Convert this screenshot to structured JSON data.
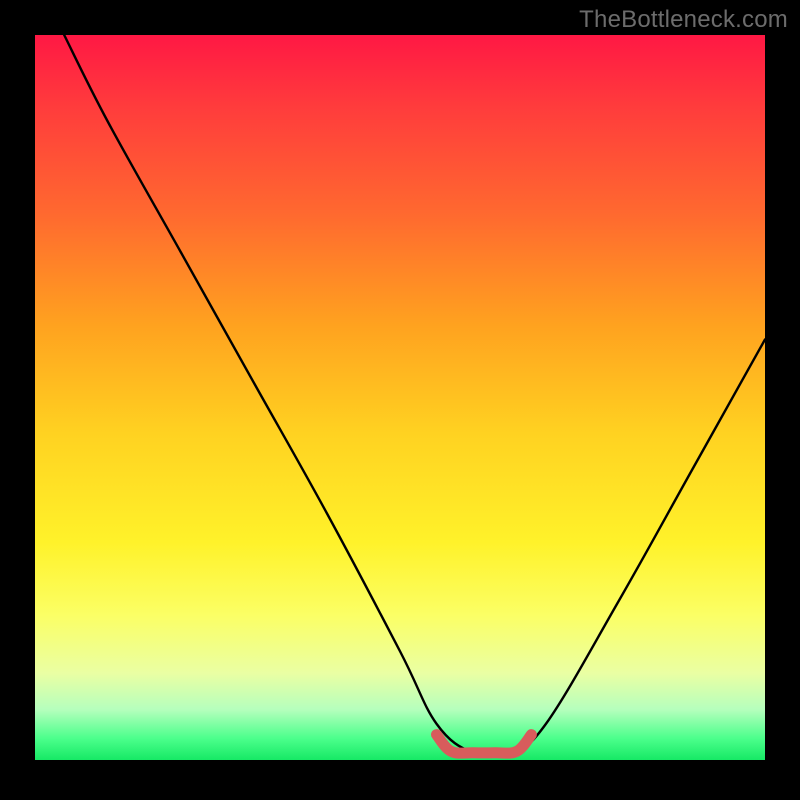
{
  "watermark": "TheBottleneck.com",
  "chart_data": {
    "type": "line",
    "title": "",
    "xlabel": "",
    "ylabel": "",
    "xlim": [
      0,
      100
    ],
    "ylim": [
      0,
      100
    ],
    "series": [
      {
        "name": "black-curve",
        "color": "#000000",
        "x": [
          4,
          10,
          20,
          30,
          40,
          50,
          55,
          60,
          65,
          70,
          80,
          90,
          100
        ],
        "y": [
          100,
          88,
          70,
          52,
          34,
          15,
          5,
          1,
          1,
          5,
          22,
          40,
          58
        ]
      },
      {
        "name": "red-flat-segment",
        "color": "#d85c5c",
        "x": [
          55,
          57,
          60,
          63,
          66,
          68
        ],
        "y": [
          3.5,
          1.2,
          1.0,
          1.0,
          1.2,
          3.5
        ]
      }
    ]
  }
}
